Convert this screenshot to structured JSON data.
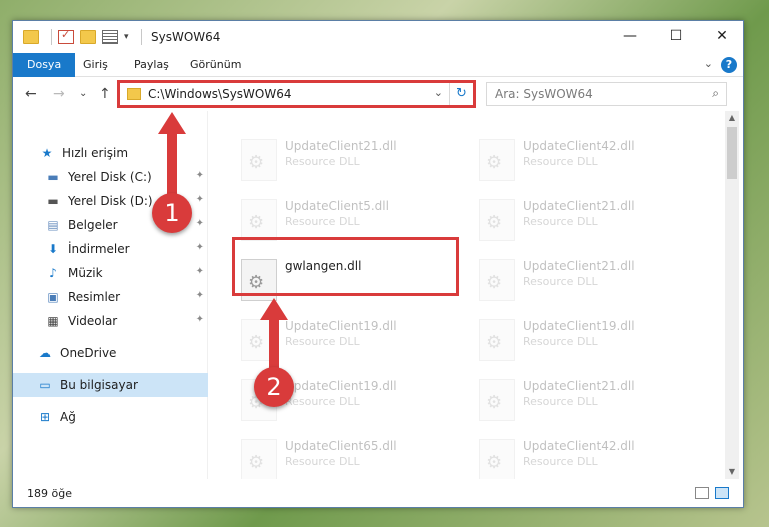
{
  "window": {
    "title": "SysWOW64",
    "minimize_glyph": "—",
    "maximize_glyph": "☐",
    "close_glyph": "✕"
  },
  "ribbon": {
    "tabs": [
      {
        "label": "Dosya",
        "active": true
      },
      {
        "label": "Giriş"
      },
      {
        "label": "Paylaş"
      },
      {
        "label": "Görünüm"
      }
    ],
    "expand_glyph": "⌄",
    "help_glyph": "?"
  },
  "nav": {
    "back_glyph": "←",
    "forward_glyph": "→",
    "recent_glyph": "⌄",
    "up_glyph": "↑",
    "address": "C:\\Windows\\SysWOW64",
    "address_dropdown_glyph": "⌄",
    "refresh_glyph": "↻",
    "search_placeholder": "Ara: SysWOW64",
    "search_glyph": "⌕"
  },
  "sidebar": {
    "items": [
      {
        "label": "Hızlı erişim",
        "icon": "star-icon",
        "glyph": "★",
        "color": "#1979ca",
        "pinned": false
      },
      {
        "label": "Yerel Disk (C:)",
        "icon": "drive-icon",
        "glyph": "▬",
        "color": "#4a7db8",
        "pinned": true
      },
      {
        "label": "Yerel Disk (D:)",
        "icon": "drive-icon",
        "glyph": "▬",
        "color": "#555555",
        "pinned": true
      },
      {
        "label": "Belgeler",
        "icon": "documents-icon",
        "glyph": "▤",
        "color": "#6a8fbf",
        "pinned": true
      },
      {
        "label": "İndirmeler",
        "icon": "download-icon",
        "glyph": "⬇",
        "color": "#1979ca",
        "pinned": true
      },
      {
        "label": "Müzik",
        "icon": "music-icon",
        "glyph": "♪",
        "color": "#1979ca",
        "pinned": true
      },
      {
        "label": "Resimler",
        "icon": "pictures-icon",
        "glyph": "▣",
        "color": "#4a7db8",
        "pinned": true
      },
      {
        "label": "Videolar",
        "icon": "videos-icon",
        "glyph": "▦",
        "color": "#444444",
        "pinned": true
      },
      {
        "label": "OneDrive",
        "icon": "cloud-icon",
        "glyph": "☁",
        "color": "#1979ca",
        "pinned": false
      },
      {
        "label": "Bu bilgisayar",
        "icon": "computer-icon",
        "glyph": "▭",
        "color": "#1979ca",
        "pinned": false,
        "selected": true
      },
      {
        "label": "Ağ",
        "icon": "network-icon",
        "glyph": "⊞",
        "color": "#1979ca",
        "pinned": false
      }
    ],
    "pin_glyph": "📌"
  },
  "files": [
    {
      "name": "UpdateClient21.dll",
      "desc": "Resource DLL",
      "faded": true
    },
    {
      "name": "UpdateClient42.dll",
      "desc": "Resource DLL",
      "faded": true
    },
    {
      "name": "UpdateClient5.dll",
      "desc": "Resource DLL",
      "faded": true
    },
    {
      "name": "UpdateClient21.dll",
      "desc": "Resource DLL",
      "faded": true
    },
    {
      "name": "gwlangen.dll",
      "desc": "",
      "faded": false
    },
    {
      "name": "UpdateClient21.dll",
      "desc": "Resource DLL",
      "faded": true
    },
    {
      "name": "UpdateClient19.dll",
      "desc": "Resource DLL",
      "faded": true
    },
    {
      "name": "UpdateClient19.dll",
      "desc": "Resource DLL",
      "faded": true
    },
    {
      "name": "UpdateClient19.dll",
      "desc": "Resource DLL",
      "faded": true
    },
    {
      "name": "UpdateClient21.dll",
      "desc": "Resource DLL",
      "faded": true
    },
    {
      "name": "UpdateClient65.dll",
      "desc": "Resource DLL",
      "faded": true
    },
    {
      "name": "UpdateClient42.dll",
      "desc": "Resource DLL",
      "faded": true
    }
  ],
  "file_icon_glyph": "⚙",
  "status": {
    "count": "189 öğe"
  },
  "annotations": {
    "marker_1": "1",
    "marker_2": "2",
    "color": "#d93b3b"
  }
}
